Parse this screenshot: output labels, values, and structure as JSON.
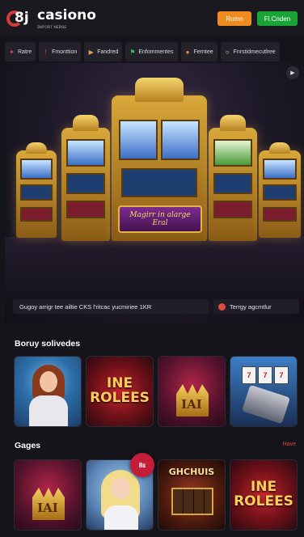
{
  "header": {
    "logo_mark": "8j",
    "brand_name": "casiono",
    "tagline": "ɪᴍᴘᴏʀᴛ ɴᴇʀɢᴇ",
    "login_label": "Rumn",
    "signup_label": "Fl.Cnden"
  },
  "tabs": [
    {
      "label": "Ratre",
      "icon": "flame-icon",
      "color": "#e04a6a"
    },
    {
      "label": "Fmonttion",
      "icon": "exclaim-icon",
      "color": "#e04a4a"
    },
    {
      "label": "Fandred",
      "icon": "tag-icon",
      "color": "#e0a04a"
    },
    {
      "label": "Enfommentes",
      "icon": "flag-icon",
      "color": "#3ac05a"
    },
    {
      "label": "Ferntee",
      "icon": "chip-icon",
      "color": "#e08a3a"
    },
    {
      "label": "Fnrstidmecutlree",
      "icon": "chat-icon",
      "color": "#dcdbe2"
    }
  ],
  "hero": {
    "sign_line1": "Magirr in alarge",
    "sign_line2": "Eral",
    "banner_text": "Gugoy arrigr tee ailtie CKS l'ritcac yucmiriee 1KR",
    "cta_label": "Terrgy agcmtlur"
  },
  "sections": {
    "bonus_title": "Boruy solivedes",
    "games_title": "Gages",
    "games_link": "Have"
  },
  "bonus_cards": [
    {
      "label": "",
      "art": "woman"
    },
    {
      "label": "INE ROLEES",
      "art": "roles"
    },
    {
      "label": "IAI",
      "art": "crown"
    },
    {
      "label": "",
      "art": "slot"
    }
  ],
  "game_cards": [
    {
      "label": "IAI",
      "art": "crown"
    },
    {
      "label": "",
      "art": "blonde"
    },
    {
      "label": "GHCHUIS",
      "art": "grid"
    },
    {
      "label": "INE ROLEES",
      "art": "roles"
    }
  ],
  "new_badge": "8ᴇ"
}
